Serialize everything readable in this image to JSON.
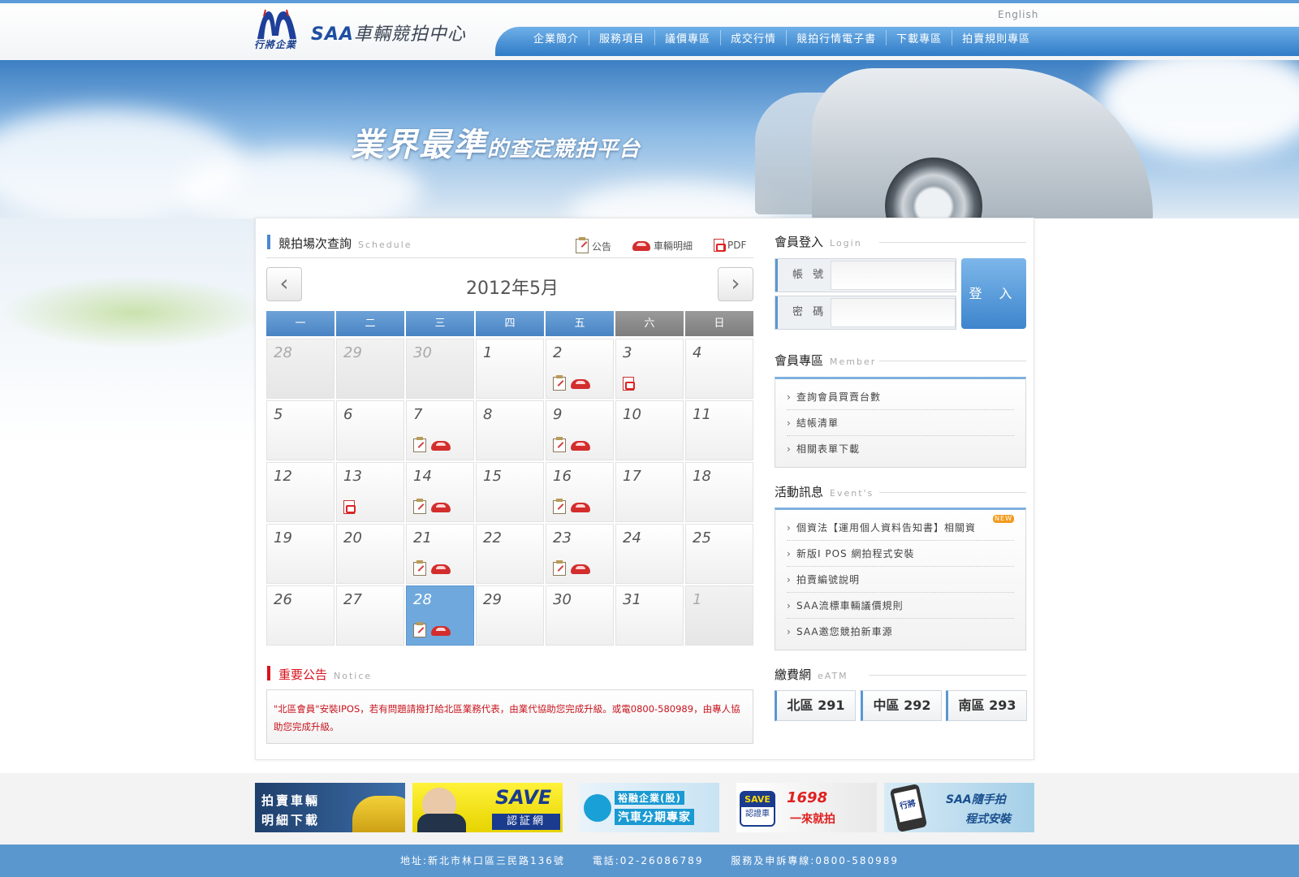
{
  "header": {
    "logo_sub": "行將企業",
    "logo_title_en": "SAA",
    "logo_title_zh": "車輛競拍中心",
    "english_link": "English",
    "nav": [
      "企業簡介",
      "服務項目",
      "議價專區",
      "成交行情",
      "競拍行情電子書",
      "下載專區",
      "拍賣規則專區"
    ]
  },
  "hero": {
    "slogan_big": "業界最準",
    "slogan_small": "的查定競拍平台"
  },
  "schedule": {
    "title": "競拍場次查詢",
    "title_en": "Schedule",
    "legend": {
      "notice": "公告",
      "car": "車輛明細",
      "pdf": "PDF"
    },
    "month": "2012年5月",
    "weekdays": [
      "一",
      "二",
      "三",
      "四",
      "五",
      "六",
      "日"
    ],
    "days": [
      {
        "d": "28",
        "other": true,
        "ic": []
      },
      {
        "d": "29",
        "other": true,
        "ic": []
      },
      {
        "d": "30",
        "other": true,
        "ic": []
      },
      {
        "d": "1",
        "ic": []
      },
      {
        "d": "2",
        "ic": [
          "note",
          "car"
        ]
      },
      {
        "d": "3",
        "ic": [
          "pdf"
        ]
      },
      {
        "d": "4",
        "ic": []
      },
      {
        "d": "5",
        "ic": []
      },
      {
        "d": "6",
        "ic": []
      },
      {
        "d": "7",
        "ic": [
          "note",
          "car"
        ]
      },
      {
        "d": "8",
        "ic": []
      },
      {
        "d": "9",
        "ic": [
          "note",
          "car"
        ]
      },
      {
        "d": "10",
        "ic": []
      },
      {
        "d": "11",
        "ic": []
      },
      {
        "d": "12",
        "ic": []
      },
      {
        "d": "13",
        "ic": [
          "pdf"
        ]
      },
      {
        "d": "14",
        "ic": [
          "note",
          "car"
        ]
      },
      {
        "d": "15",
        "ic": []
      },
      {
        "d": "16",
        "ic": [
          "note",
          "car"
        ]
      },
      {
        "d": "17",
        "ic": []
      },
      {
        "d": "18",
        "ic": []
      },
      {
        "d": "19",
        "ic": []
      },
      {
        "d": "20",
        "ic": []
      },
      {
        "d": "21",
        "ic": [
          "note",
          "car"
        ]
      },
      {
        "d": "22",
        "ic": []
      },
      {
        "d": "23",
        "ic": [
          "note",
          "car"
        ]
      },
      {
        "d": "24",
        "ic": []
      },
      {
        "d": "25",
        "ic": []
      },
      {
        "d": "26",
        "ic": []
      },
      {
        "d": "27",
        "ic": []
      },
      {
        "d": "28",
        "today": true,
        "ic": [
          "note",
          "car"
        ]
      },
      {
        "d": "29",
        "ic": []
      },
      {
        "d": "30",
        "ic": []
      },
      {
        "d": "31",
        "ic": []
      },
      {
        "d": "1",
        "other": true,
        "ic": []
      }
    ]
  },
  "notice": {
    "title": "重要公告",
    "title_en": "Notice",
    "text": "\"北區會員\"安裝IPOS，若有問題請撥打給北區業務代表，由業代協助您完成升級。或電0800-580989，由專人協助您完成升級。"
  },
  "login": {
    "title": "會員登入",
    "title_en": "Login",
    "account_label": "帳 號",
    "password_label": "密 碼",
    "button": "登 入"
  },
  "member": {
    "title": "會員專區",
    "title_en": "Member",
    "items": [
      "查詢會員買賣台數",
      "結帳清單",
      "相關表單下載"
    ]
  },
  "events": {
    "title": "活動訊息",
    "title_en": "Event's",
    "new_tag": "NEW",
    "items": [
      "個資法【運用個人資料告知書】相關資",
      "新版I POS 網拍程式安裝",
      "拍賣編號說明",
      "SAA流標車輛議價規則",
      "SAA邀您競拍新車源"
    ]
  },
  "eatm": {
    "title": "繳費網",
    "title_en": "eATM",
    "buttons": [
      "北區 291",
      "中區 292",
      "南區 293"
    ]
  },
  "banners": {
    "b1": "拍賣車輛\n明細下載",
    "b2_big": "SAVE",
    "b2_small": "認証網",
    "b3_line1": "裕融企業(股)",
    "b3_line2": "汽車分期專家",
    "b4_save": "SAVE",
    "b4_save_sub": "認證車",
    "b4_num": "1698",
    "b4_slogan": "一來就拍",
    "b5_line1": "SAA隨手拍",
    "b5_line2": "程式安裝",
    "b5_phone": "行將"
  },
  "footer": {
    "address": "地址:新北市林口區三民路136號",
    "phone": "電話:02-26086789",
    "hotline": "服務及申訴專線:0800-580989"
  }
}
